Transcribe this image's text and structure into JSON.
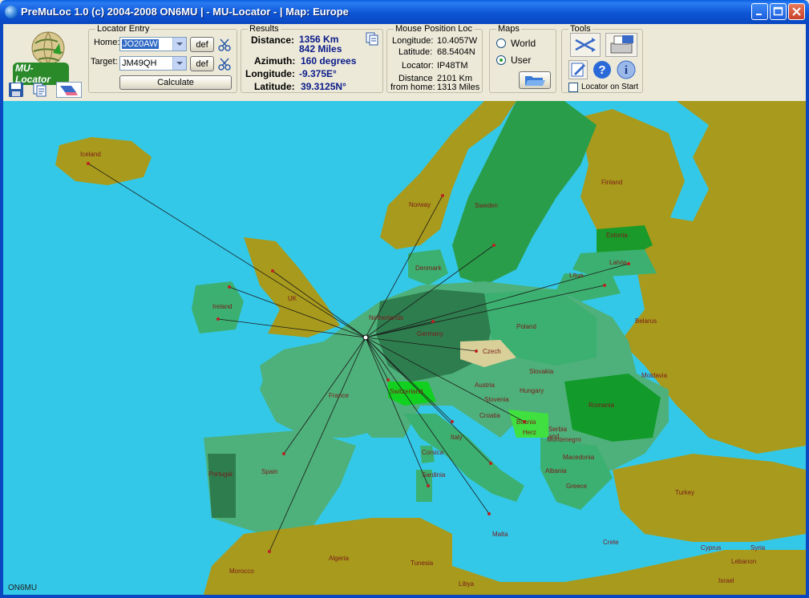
{
  "window": {
    "title": "PreMuLoc 1.0 (c) 2004-2008 ON6MU  | - MU-Locator - |  Map: Europe"
  },
  "logo": {
    "text": "MU-Locator"
  },
  "locator_entry": {
    "label": "Locator Entry",
    "home_label": "Home:",
    "home_value": "JO20AW",
    "target_label": "Target:",
    "target_value": "JM49QH",
    "def_label": "def",
    "calculate_label": "Calculate"
  },
  "results": {
    "label": "Results",
    "distance_label": "Distance:",
    "distance_km": "1356 Km",
    "distance_miles": "842 Miles",
    "azimuth_label": "Azimuth:",
    "azimuth_value": "160 degrees",
    "longitude_label": "Longitude:",
    "longitude_value": "-9.375E°",
    "latitude_label": "Latitude:",
    "latitude_value": "39.3125N°"
  },
  "mouse_position": {
    "label": "Mouse Position Loc",
    "longitude_label": "Longitude:",
    "longitude_value": "10.4057W",
    "latitude_label": "Latitude:",
    "latitude_value": "68.5404N",
    "locator_label": "Locator:",
    "locator_value": "IP48TM",
    "distance_label": "Distance",
    "from_home_label": "from home:",
    "distance_km": "2101 Km",
    "distance_miles": "1313 Miles"
  },
  "maps": {
    "label": "Maps",
    "world_label": "World",
    "user_label": "User",
    "selected": "User"
  },
  "tools": {
    "label": "Tools",
    "locator_on_start_label": "Locator on Start",
    "locator_on_start_checked": false
  },
  "map": {
    "watermark": "ON6MU",
    "countries": [
      "Iceland",
      "Norway",
      "Sweden",
      "Finland",
      "Estonia",
      "Latvia",
      "Litua",
      "Denmark",
      "UK",
      "Ireland",
      "Netherlands",
      "Germany",
      "Poland",
      "Belarus",
      "Czech",
      "Slovakia",
      "Moldavia",
      "Austria",
      "Hungary",
      "Switzerland",
      "Slovenia",
      "Romania",
      "Croatia",
      "Bosnia",
      "Herz",
      "Serbia and",
      "Montenegro",
      "France",
      "Italy",
      "Corsica",
      "Sardinia",
      "Macedonia",
      "Albania",
      "Greece",
      "Turkey",
      "Spain",
      "Portugal",
      "Malta",
      "Algeria",
      "Morocco",
      "Tunesia",
      "Libya",
      "Crete",
      "Cyprus",
      "Syria",
      "Lebanon",
      "Israel"
    ]
  },
  "colors": {
    "sea": "#34c8e8",
    "land": "#a89a1c",
    "visited_green": "#4eb07a",
    "dark_green": "#2e7d4e",
    "bright_green": "#10a010"
  }
}
